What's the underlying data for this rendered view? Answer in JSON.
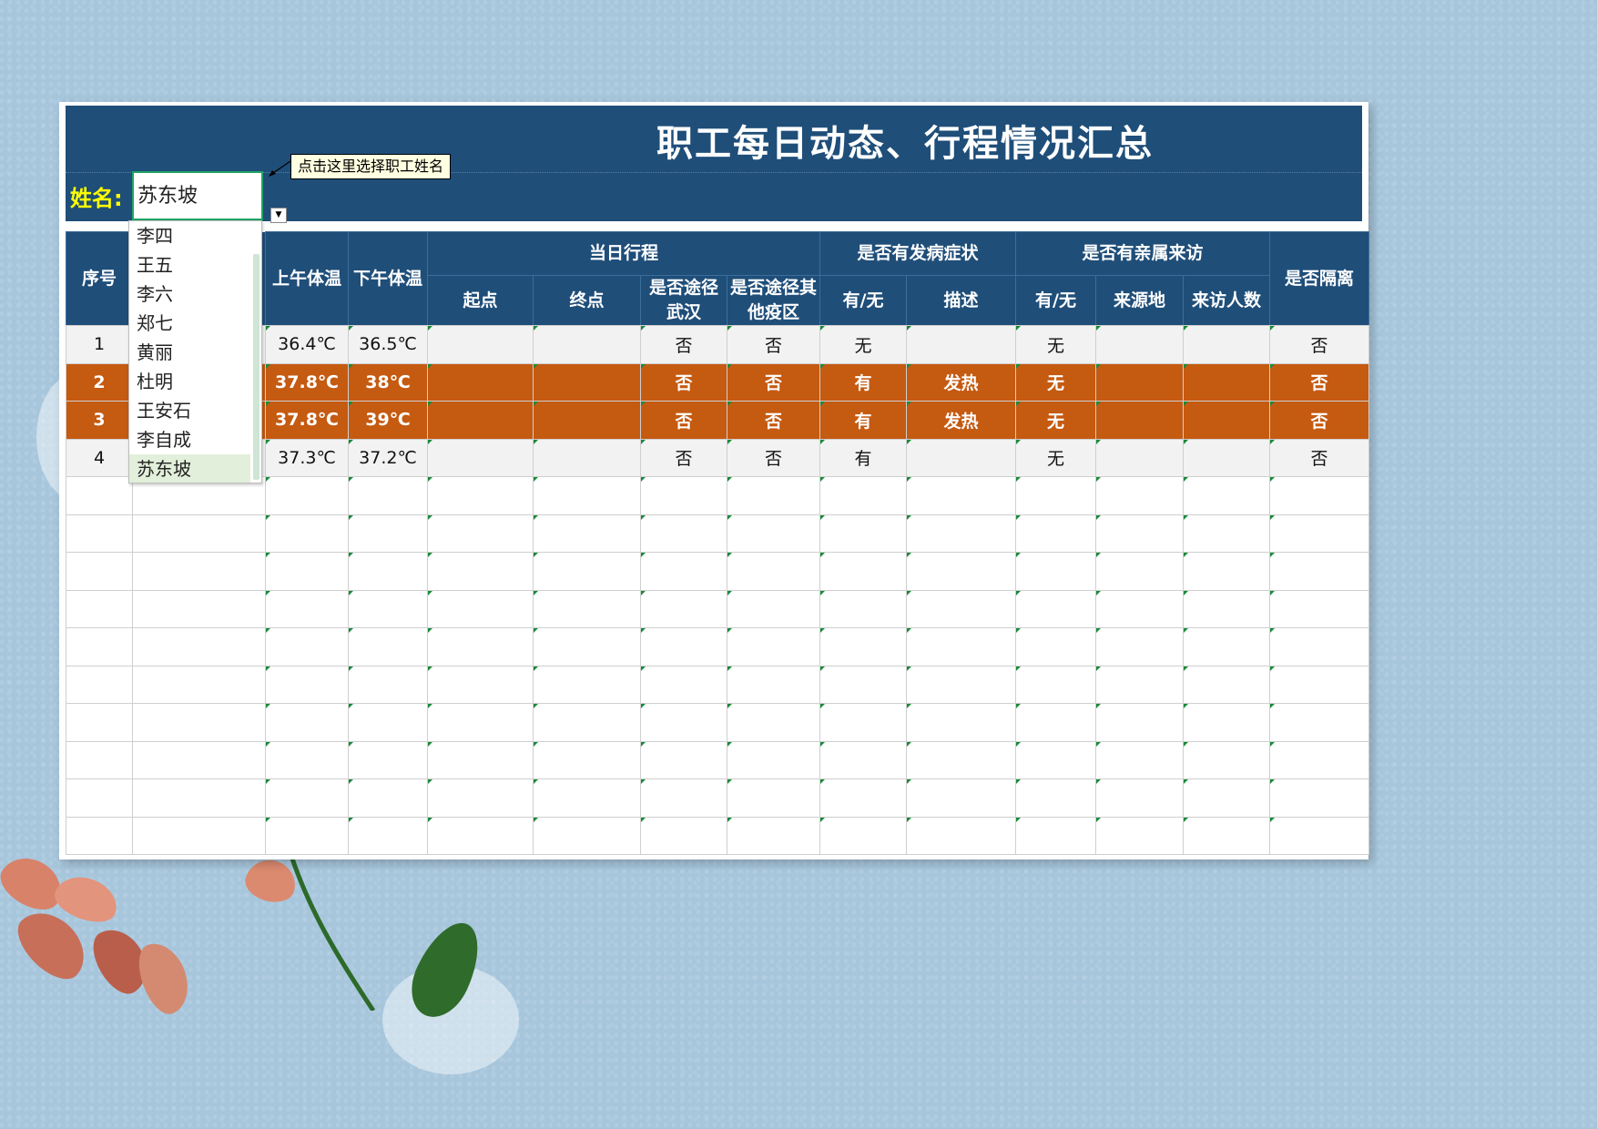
{
  "sheet": {
    "title": "职工每日动态、行程情况汇总",
    "name_label": "姓名:",
    "selected_name": "苏东坡",
    "comment": "点击这里选择职工姓名"
  },
  "dropdown": {
    "options": [
      "李四",
      "王五",
      "李六",
      "郑七",
      "黄丽",
      "杜明",
      "王安石",
      "李自成",
      "苏东坡"
    ],
    "selected_index": 8
  },
  "headers": {
    "seq": "序号",
    "am_temp": "上午体温",
    "pm_temp": "下午体温",
    "trip": "当日行程",
    "symptoms": "是否有发病症状",
    "visitors": "是否有亲属来访",
    "isolated": "是否隔离",
    "start": "起点",
    "end": "终点",
    "via_wuhan": "是否途径武汉",
    "via_other": "是否途径其他疫区",
    "sym_has": "有/无",
    "sym_desc": "描述",
    "vis_has": "有/无",
    "vis_origin": "来源地",
    "vis_count": "来访人数"
  },
  "rows": [
    {
      "seq": "1",
      "am": "36.4℃",
      "pm": "36.5℃",
      "start": "",
      "end": "",
      "via_wuhan": "否",
      "via_other": "否",
      "sym_has": "无",
      "sym_desc": "",
      "vis_has": "无",
      "vis_origin": "",
      "vis_count": "",
      "isolated": "否",
      "alert": false
    },
    {
      "seq": "2",
      "am": "37.8℃",
      "pm": "38℃",
      "start": "",
      "end": "",
      "via_wuhan": "否",
      "via_other": "否",
      "sym_has": "有",
      "sym_desc": "发热",
      "vis_has": "无",
      "vis_origin": "",
      "vis_count": "",
      "isolated": "否",
      "alert": true
    },
    {
      "seq": "3",
      "am": "37.8℃",
      "pm": "39℃",
      "start": "",
      "end": "",
      "via_wuhan": "否",
      "via_other": "否",
      "sym_has": "有",
      "sym_desc": "发热",
      "vis_has": "无",
      "vis_origin": "",
      "vis_count": "",
      "isolated": "否",
      "alert": true
    },
    {
      "seq": "4",
      "am": "37.3℃",
      "pm": "37.2℃",
      "start": "",
      "end": "",
      "via_wuhan": "否",
      "via_other": "否",
      "sym_has": "有",
      "sym_desc": "",
      "vis_has": "无",
      "vis_origin": "",
      "vis_count": "",
      "isolated": "否",
      "alert": false
    }
  ],
  "empty_rows": 10,
  "colors": {
    "header_bg": "#1f4e79",
    "alert_row": "#c55a11",
    "name_label": "#ffff00",
    "page_bg": "#a7c6dc"
  }
}
